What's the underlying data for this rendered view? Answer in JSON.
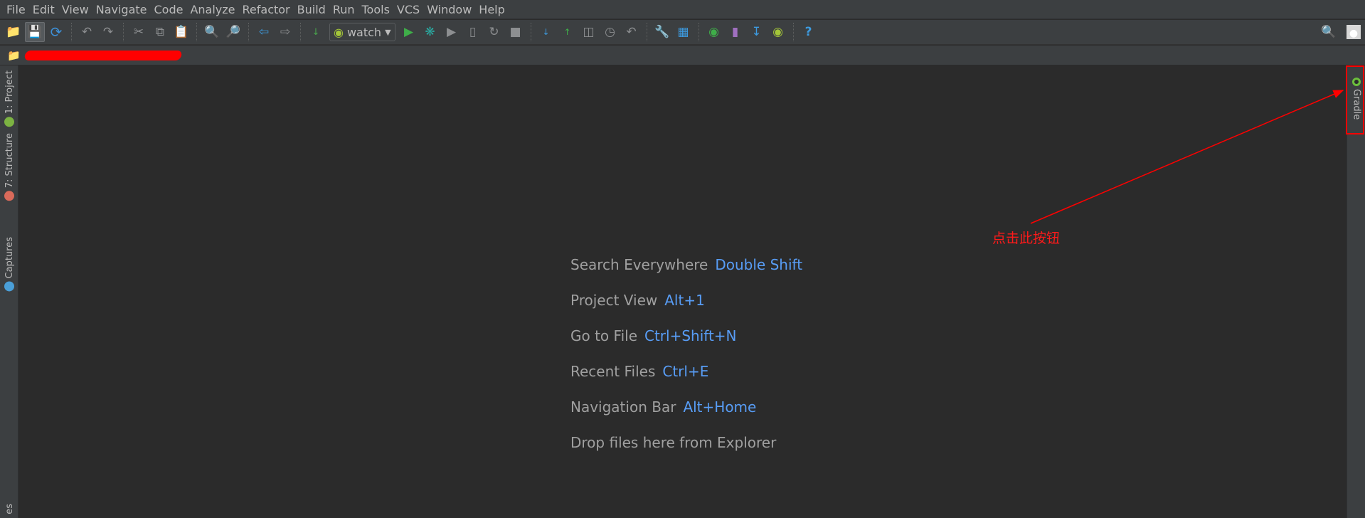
{
  "menu": [
    {
      "label": "File"
    },
    {
      "label": "Edit"
    },
    {
      "label": "View"
    },
    {
      "label": "Navigate"
    },
    {
      "label": "Code"
    },
    {
      "label": "Analyze"
    },
    {
      "label": "Refactor"
    },
    {
      "label": "Build"
    },
    {
      "label": "Run"
    },
    {
      "label": "Tools"
    },
    {
      "label": "VCS"
    },
    {
      "label": "Window"
    },
    {
      "label": "Help"
    }
  ],
  "toolbar": {
    "run_config": "watch"
  },
  "left_tabs": [
    {
      "label": "1: Project"
    },
    {
      "label": "7: Structure"
    },
    {
      "label": "Captures"
    },
    {
      "label": "es"
    }
  ],
  "right_tabs": [
    {
      "label": "Gradle"
    }
  ],
  "hints": [
    {
      "text": "Search Everywhere",
      "key": "Double Shift"
    },
    {
      "text": "Project View",
      "key": "Alt+1"
    },
    {
      "text": "Go to File",
      "key": "Ctrl+Shift+N"
    },
    {
      "text": "Recent Files",
      "key": "Ctrl+E"
    },
    {
      "text": "Navigation Bar",
      "key": "Alt+Home"
    },
    {
      "text": "Drop files here from Explorer",
      "key": ""
    }
  ],
  "annotation": "点击此按钮",
  "colors": {
    "chrome": "#3c3f41",
    "editor": "#2b2b2b",
    "shortcut": "#589df6",
    "annotation": "#ff0000"
  }
}
